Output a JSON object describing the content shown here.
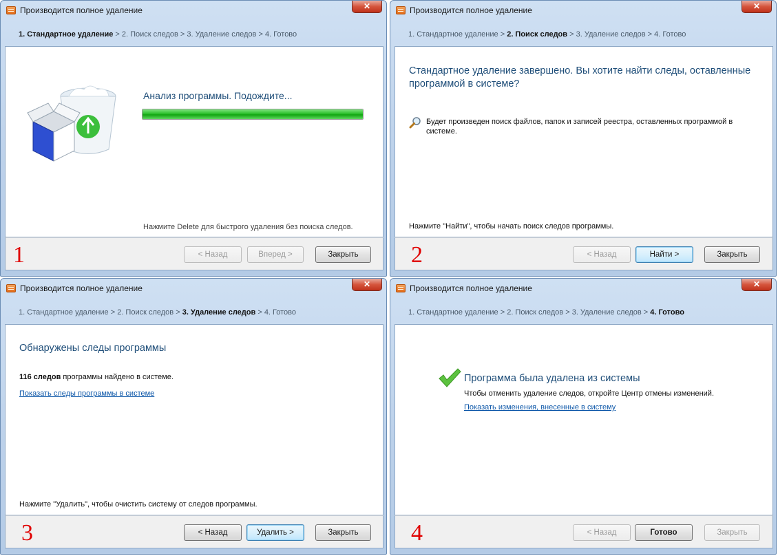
{
  "windows": [
    {
      "title": "Производится полное удаление",
      "close": "✕",
      "steps": [
        "1. Стандартное удаление",
        "2. Поиск следов",
        "3. Удаление следов",
        "4. Готово"
      ],
      "active_step": 0,
      "number": "1",
      "heading": "Анализ программы. Подождите...",
      "progress": 1.0,
      "hint": "Нажмите Delete для быстрого удаления без поиска следов.",
      "buttons": [
        "< Назад",
        "Вперед >",
        "Закрыть"
      ]
    },
    {
      "title": "Производится полное удаление",
      "close": "✕",
      "steps": [
        "1. Стандартное удаление",
        "2. Поиск следов",
        "3. Удаление следов",
        "4. Готово"
      ],
      "active_step": 1,
      "number": "2",
      "heading": "Стандартное удаление завершено. Вы хотите найти следы, оставленные программой в системе?",
      "info_text": "Будет произведен поиск файлов, папок и записей реестра, оставленных программой в системе.",
      "hint": "Нажмите \"Найти\", чтобы начать поиск следов программы.",
      "buttons": [
        "< Назад",
        "Найти >",
        "Закрыть"
      ]
    },
    {
      "title": "Производится полное удаление",
      "close": "✕",
      "steps": [
        "1. Стандартное удаление",
        "2. Поиск следов",
        "3. Удаление следов",
        "4. Готово"
      ],
      "active_step": 2,
      "number": "3",
      "heading": "Обнаружены следы программы",
      "count_bold": "116 следов",
      "count_rest": " программы найдено в системе.",
      "link": "Показать следы программы в системе",
      "hint": "Нажмите \"Удалить\", чтобы очистить систему от следов программы.",
      "buttons": [
        "< Назад",
        "Удалить >",
        "Закрыть"
      ]
    },
    {
      "title": "Производится полное удаление",
      "close": "✕",
      "steps": [
        "1. Стандартное удаление",
        "2. Поиск следов",
        "3. Удаление следов",
        "4. Готово"
      ],
      "active_step": 3,
      "number": "4",
      "heading": "Программа была удалена из системы",
      "info_text": "Чтобы отменить удаление следов, откройте Центр отмены изменений.",
      "link": "Показать изменения, внесенные в систему",
      "buttons": [
        "< Назад",
        "Готово",
        "Закрыть"
      ]
    }
  ],
  "colors": {
    "heading": "#1f4e79",
    "link": "#0b56a8",
    "number": "#e00000",
    "progress": "#2bc02b",
    "check": "#5cc23f"
  },
  "icons": [
    "uninstall-box-trash-icon",
    "search-magnifier-icon",
    "green-checkmark-icon",
    "window-close-icon"
  ]
}
